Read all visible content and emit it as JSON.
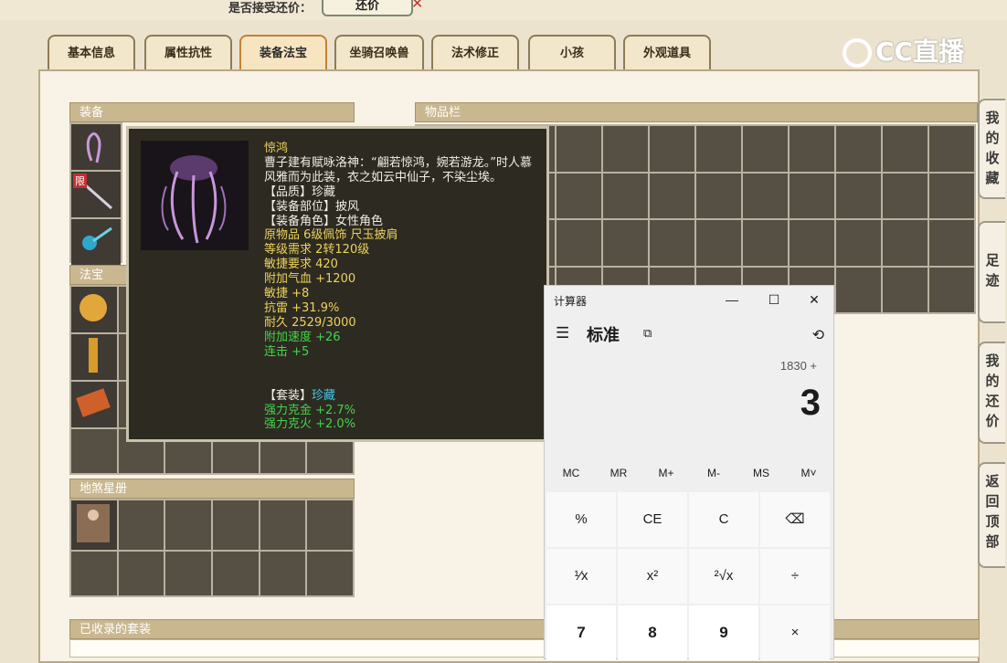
{
  "top": {
    "offer_label": "是否接受还价：",
    "counter_button": "还价"
  },
  "tabs": [
    "基本信息",
    "属性抗性",
    "装备法宝",
    "坐骑召唤兽",
    "法术修正",
    "小孩",
    "外观道具"
  ],
  "active_tab": "装备法宝",
  "logo": {
    "text": "CC直播"
  },
  "panels": {
    "equipment": "装备",
    "inventory": "物品栏",
    "magic": "法宝",
    "star_book": "地煞星册",
    "sets": "已收录的套装"
  },
  "badge_limit": "限",
  "tooltip": {
    "name": "惊鸿",
    "desc": "曹子建有赋咏洛神：“翩若惊鸿，婉若游龙。”时人慕风雅而为此装，衣之如云中仙子，不染尘埃。",
    "quality": "【品质】珍藏",
    "slot": "【装备部位】披风",
    "role": "【装备角色】女性角色",
    "origin": "原物品 6级佩饰 尺玉披肩",
    "level_req": "等级需求 2转120级",
    "agility_req": "敏捷要求 420",
    "hp": "附加气血 +1200",
    "agility": "敏捷 +8",
    "thunder": "抗雷 +31.9%",
    "durability": "耐久 2529/3000",
    "speed": "附加速度 +26",
    "combo": "连击 +5",
    "set_label": "【套装】",
    "set_value": "珍藏",
    "set_bonus_1": "强力克金 +2.7%",
    "set_bonus_2": "强力克火 +2.0%"
  },
  "calculator": {
    "title": "计算器",
    "mode": "标准",
    "expression": "1830 +",
    "display": "3",
    "memory": [
      "MC",
      "MR",
      "M+",
      "M-",
      "MS",
      "M˅"
    ],
    "keys": [
      "%",
      "CE",
      "C",
      "⌫",
      "¹⁄x",
      "x²",
      "²√x",
      "÷",
      "7",
      "8",
      "9",
      "×"
    ]
  },
  "side_tabs": [
    [
      "我",
      "的",
      "收",
      "藏"
    ],
    [
      "足",
      "迹"
    ],
    [
      "我",
      "的",
      "还",
      "价"
    ],
    [
      "返",
      "回",
      "顶",
      "部"
    ]
  ]
}
